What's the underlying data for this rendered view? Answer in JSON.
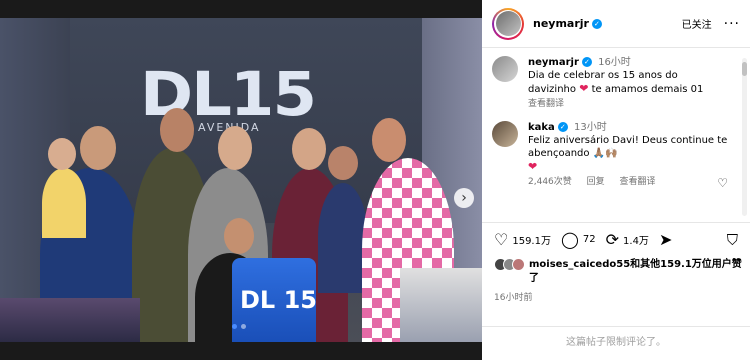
{
  "post": {
    "username": "neymarjr",
    "follow_status": "已关注",
    "more_icon": "more-horizontal-icon"
  },
  "photo": {
    "logo_text": "DL15",
    "logo_sub": "AVENIDA",
    "cake_text": "DL 15",
    "slide_count": 2,
    "active_slide": 1
  },
  "comments": [
    {
      "username": "neymarjr",
      "time": "16小时",
      "text": "Dia de celebrar os 15 anos do davizinho",
      "text_tail": "te amamos demais 01",
      "translate": "查看翻译"
    },
    {
      "username": "kaka",
      "time": "13小时",
      "text": "Feliz aniversário Davi! Deus continue te abençoando",
      "emoji": "🙏🏽🙌🏽",
      "likes": "2,446次赞",
      "reply": "回复",
      "translate": "查看翻译"
    }
  ],
  "actions": {
    "likes": "159.1万",
    "comments": "72",
    "reposts": "1.4万"
  },
  "likers": {
    "name": "moises_caicedo55",
    "text": "和其他159.1万位用户赞了"
  },
  "post_time": "16小时前",
  "comments_limited": "这篇帖子限制评论了。",
  "colors": {
    "verified": "#0095f6",
    "heart": "#e0245e",
    "dot_active": "#4a8cff"
  }
}
